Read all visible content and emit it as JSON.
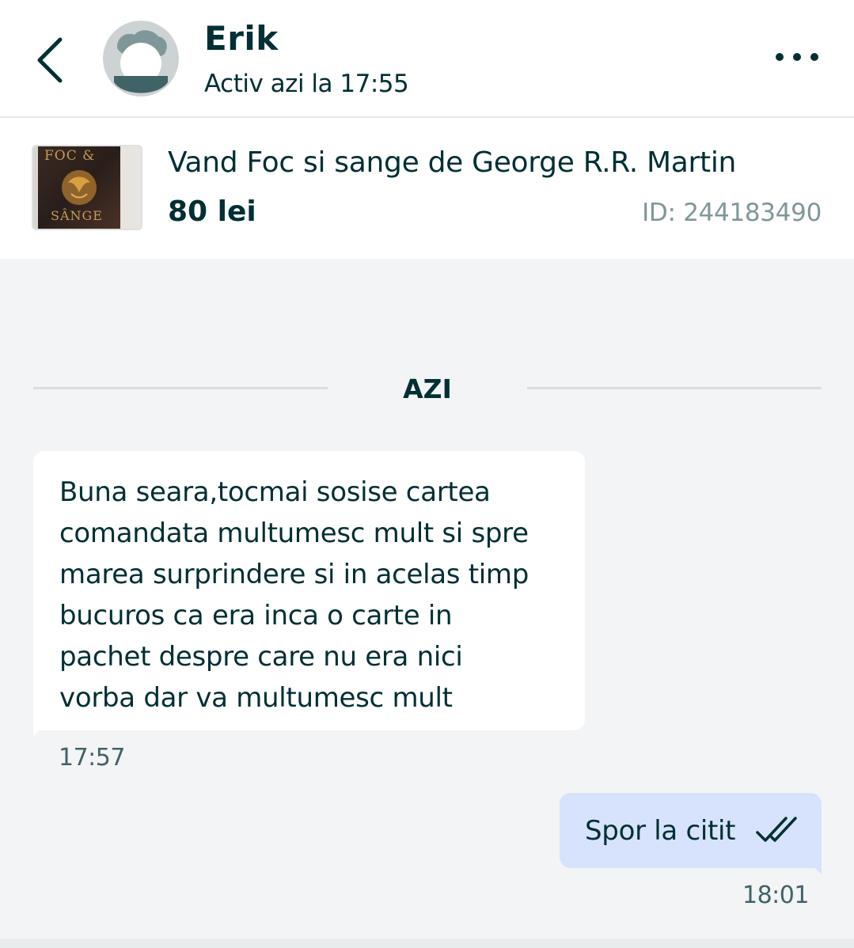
{
  "header": {
    "user_name": "Erik",
    "status": "Activ azi la 17:55",
    "back_icon": "chevron-left-icon",
    "more_icon": "more-dots-icon"
  },
  "listing": {
    "title": "Vand Foc si sange de George R.R. Martin",
    "price": "80 lei",
    "id_text": "ID: 244183490",
    "thumbnail_text": {
      "top": "FOC &",
      "bottom": "SÂNGE"
    }
  },
  "conversation": {
    "day_label": "AZI",
    "messages": [
      {
        "direction": "incoming",
        "text": "Buna seara,tocmai sosise cartea\ncomandata multumesc mult si spre\nmarea surprindere si in acelas timp\nbucuros ca era inca o carte in\npachet despre care nu era nici\nvorba dar va multumesc mult",
        "time": "17:57"
      },
      {
        "direction": "outgoing",
        "text": "Spor la citit",
        "time": "18:01",
        "status_icon": "double-check-icon"
      }
    ]
  },
  "colors": {
    "primary_text": "#002f34",
    "muted_text": "#7f9799",
    "background": "#f2f4f5",
    "incoming_bubble": "#ffffff",
    "outgoing_bubble": "#d7e3fd"
  }
}
